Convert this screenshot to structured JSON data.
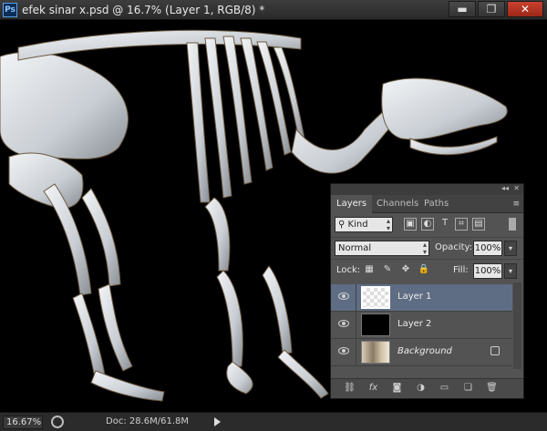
{
  "window": {
    "app_icon": "Ps",
    "title": "efek sinar x.psd @ 16.7% (Layer 1, RGB/8) *",
    "buttons": [
      "▬",
      "❐",
      "✕"
    ]
  },
  "status": {
    "zoom": "16.67%",
    "doc": "Doc: 28.6M/61.8M"
  },
  "layers_panel": {
    "collapse_glyph": "◂◂",
    "close_glyph": "✕",
    "menu_glyph": "≡",
    "tabs": [
      "Layers",
      "Channels",
      "Paths"
    ],
    "filter": {
      "kind_label": "Kind"
    },
    "blend_mode": "Normal",
    "opacity_label": "Opacity:",
    "opacity_value": "100%",
    "lock_label": "Lock:",
    "fill_label": "Fill:",
    "fill_value": "100%",
    "layers": [
      {
        "name": "Layer 1",
        "selected": true
      },
      {
        "name": "Layer 2",
        "selected": false
      },
      {
        "name": "Background",
        "selected": false,
        "locked": true
      }
    ]
  }
}
